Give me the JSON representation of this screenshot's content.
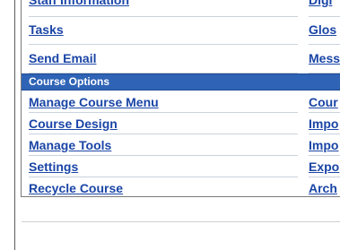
{
  "top_links": {
    "staff_information": "Staff Information",
    "digital": "Digi",
    "tasks": "Tasks",
    "glossary": "Glos",
    "send_email": "Send Email",
    "messages": "Mess"
  },
  "course_options": {
    "title": "Course Options",
    "left_items": [
      {
        "label": "Manage Course Menu"
      },
      {
        "label": "Course Design"
      },
      {
        "label": "Manage Tools"
      },
      {
        "label": "Settings"
      },
      {
        "label": "Recycle Course"
      }
    ],
    "right_items": [
      {
        "label": "Cour"
      },
      {
        "label": "Impo"
      },
      {
        "label": "Impo"
      },
      {
        "label": "Expo"
      },
      {
        "label": "Arch"
      }
    ]
  },
  "colors": {
    "link": "#1a45a6",
    "section_bar": "#2f63b6"
  }
}
